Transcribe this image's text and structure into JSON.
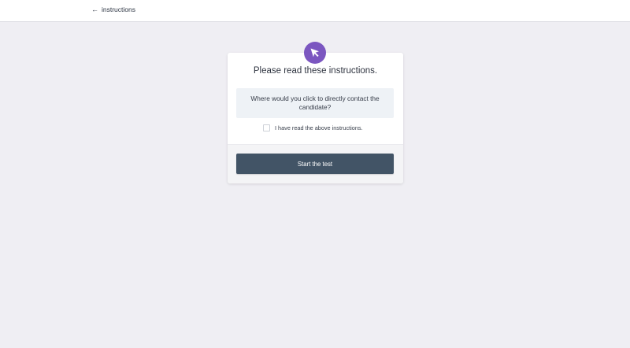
{
  "header": {
    "back_arrow": "←",
    "back_label": "instructions"
  },
  "card": {
    "icon": "cursor-icon",
    "title": "Please read these instructions.",
    "question": "Where would you click to directly contact the candidate?",
    "checkbox_label": "I have read the above instructions.",
    "checkbox_checked": false,
    "start_button_label": "Start the test"
  },
  "colors": {
    "accent": "#7b56c0",
    "button": "#425466",
    "background": "#efeef3"
  }
}
